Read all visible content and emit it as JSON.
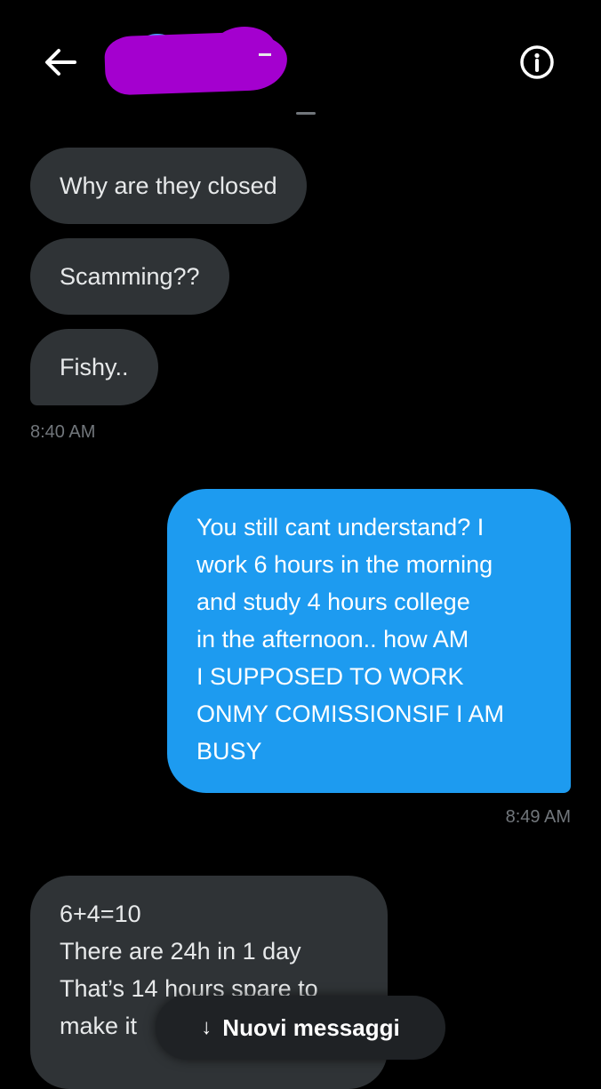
{
  "header": {
    "back_icon": "arrow-left-icon",
    "info_icon": "info-icon"
  },
  "messages": [
    {
      "text": "Why are they closed",
      "side": "received"
    },
    {
      "text": "Scamming??",
      "side": "received"
    },
    {
      "text": "Fishy..",
      "side": "received"
    }
  ],
  "received_time_1": "8:40 AM",
  "sent_message": {
    "lines": [
      "You still cant understand? I",
      "work 6 hours in the morning",
      "and study 4 hours college",
      "in the afternoon.. how AM",
      "I SUPPOSED TO  WORK",
      "ONMY COMISSIONSIF I AM",
      "BUSY"
    ],
    "time": "8:49 AM"
  },
  "last_message": {
    "lines": [
      "6+4=10",
      "There are 24h in 1 day",
      "That’s 14 hours spare to",
      "make it"
    ]
  },
  "new_messages_pill": {
    "icon": "arrow-down-icon",
    "label": "Nuovi messaggi"
  },
  "colors": {
    "background": "#000000",
    "received_bubble": "#2f3336",
    "sent_bubble": "#1d9bf0",
    "timestamp": "#71767b",
    "redaction": "#a400cf"
  }
}
